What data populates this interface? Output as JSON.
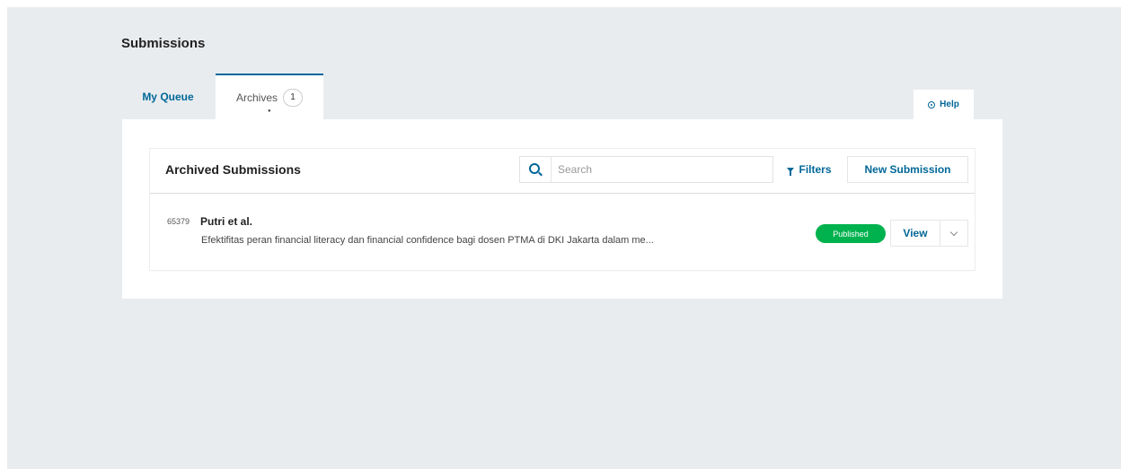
{
  "page": {
    "title": "Submissions"
  },
  "tabs": [
    {
      "label": "My Queue"
    },
    {
      "label": "Archives",
      "count": "1"
    }
  ],
  "help": {
    "label": "Help",
    "icon": "help-icon"
  },
  "archived_list": {
    "title": "Archived Submissions",
    "search": {
      "placeholder": "Search",
      "value": "",
      "icon": "search-icon"
    },
    "filters_label": "Filters",
    "new_submission_label": "New Submission",
    "items": [
      {
        "id": "65379",
        "author": "Putri et al.",
        "title": "Efektifitas peran financial literacy dan financial confidence bagi dosen PTMA di DKI Jakarta dalam me...",
        "status": "Published",
        "view_label": "View"
      }
    ]
  },
  "colors": {
    "accent": "#006798",
    "published": "#00b24e",
    "background": "#e9ecef"
  }
}
